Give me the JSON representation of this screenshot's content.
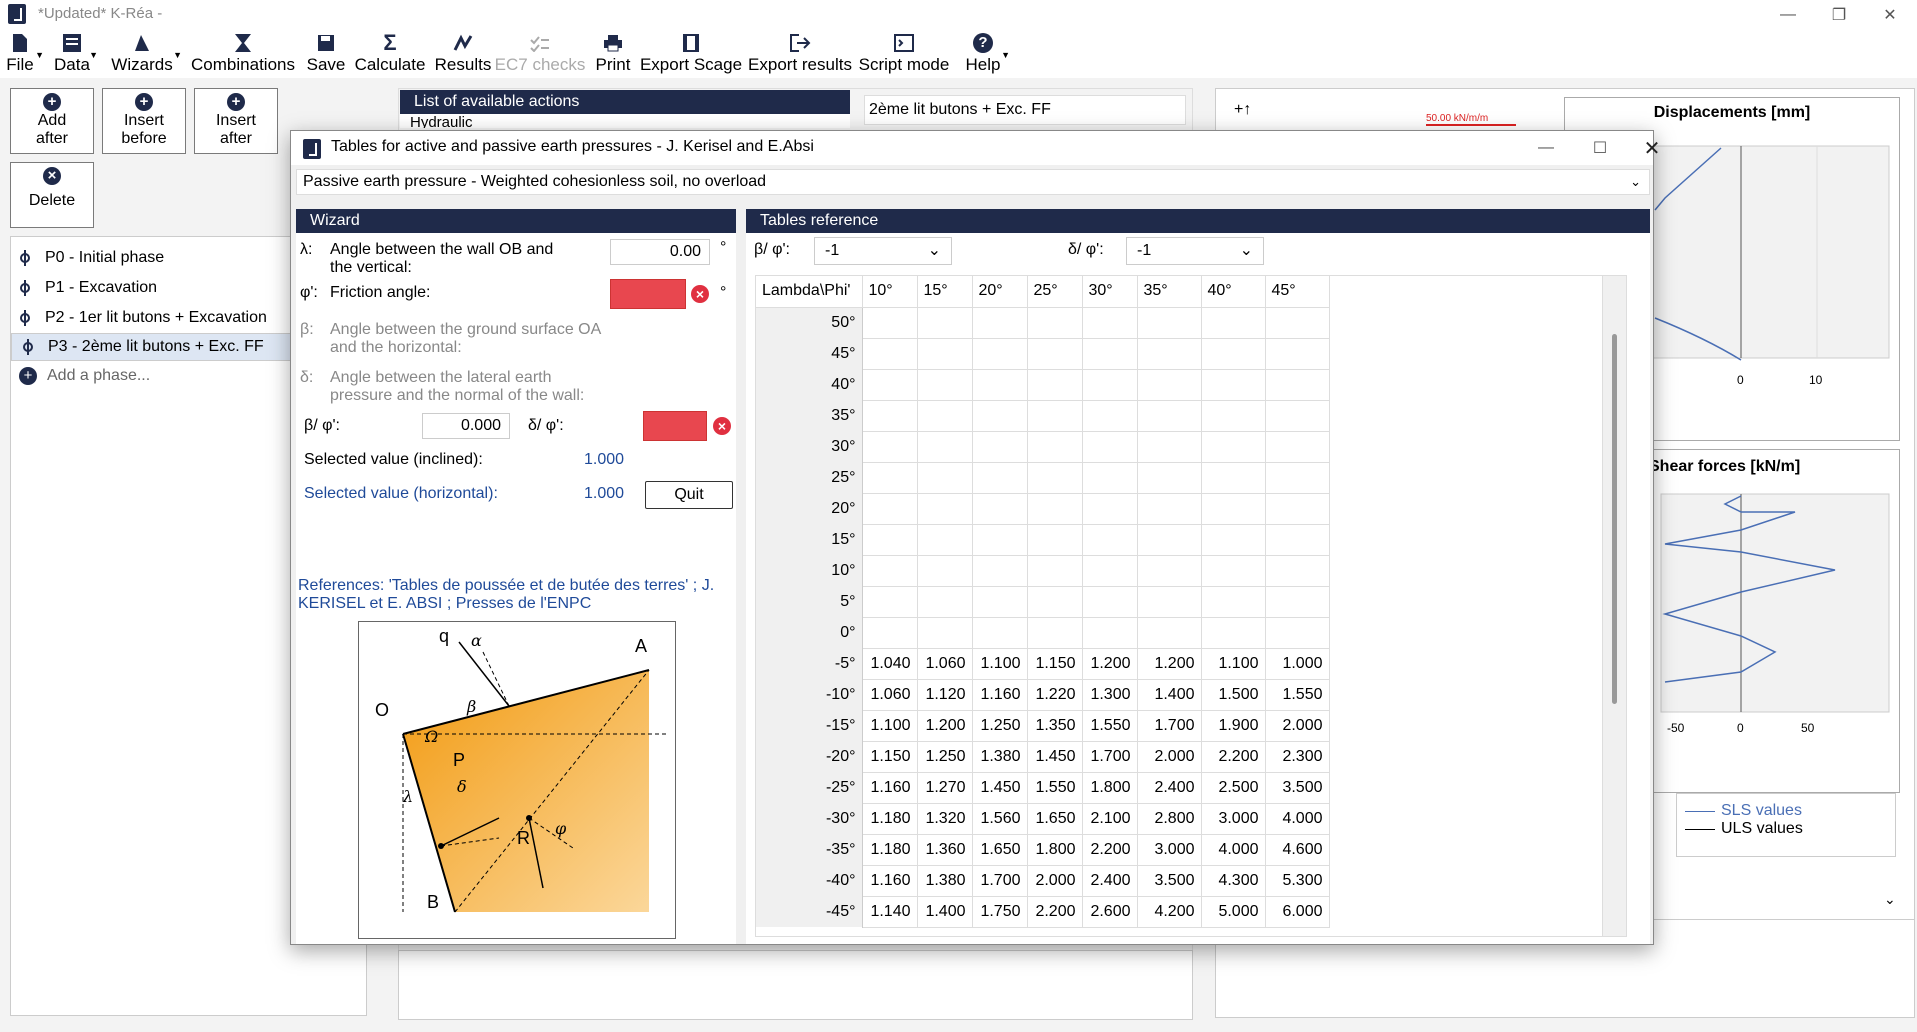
{
  "app": {
    "title": "*Updated* K-Réa -"
  },
  "ribbon": [
    {
      "label": "File",
      "icon": "file-icon",
      "dropdown": true
    },
    {
      "label": "Data",
      "icon": "data-icon",
      "dropdown": true
    },
    {
      "label": "Wizards",
      "icon": "wizard-hat-icon",
      "dropdown": true
    },
    {
      "label": "Combinations",
      "icon": "hourglass-icon"
    },
    {
      "label": "Save",
      "icon": "save-icon"
    },
    {
      "label": "Calculate",
      "icon": "sigma-icon"
    },
    {
      "label": "Results",
      "icon": "results-icon"
    },
    {
      "label": "EC7 checks",
      "icon": "checks-icon",
      "disabled": true
    },
    {
      "label": "Print",
      "icon": "printer-icon"
    },
    {
      "label": "Export Scage",
      "icon": "export-scage-icon"
    },
    {
      "label": "Export results",
      "icon": "export-icon"
    },
    {
      "label": "Script mode",
      "icon": "script-icon"
    },
    {
      "label": "Help",
      "icon": "help-icon",
      "dropdown": true
    }
  ],
  "phase_buttons": {
    "add_after": "Add\nafter",
    "insert_before": "Insert\nbefore",
    "insert_after": "Insert\nafter",
    "delete": "Delete"
  },
  "phases": [
    "P0 - Initial phase",
    "P1 - Excavation",
    "P2 - 1er lit butons + Excavation",
    "P3 - 2ème lit butons + Exc. FF"
  ],
  "phases_selected_index": 3,
  "add_phase": "Add a phase...",
  "actions": {
    "header": "List of available actions",
    "first_item": "Hydraulic"
  },
  "current_phase": "2ème lit butons + Exc. FF",
  "right_panel": {
    "toolbar_label": "+↑",
    "load_label": "50.00 kN/m/m",
    "displacements_title": "Displacements [mm]",
    "displacements_ticks": [
      "0",
      "10"
    ],
    "shear_title": "Shear forces [kN/m]",
    "shear_ticks": [
      "-50",
      "0",
      "50"
    ],
    "legend": [
      "SLS values",
      "ULS values"
    ]
  },
  "dialog": {
    "title": "Tables for active and passive earth pressures - J. Kerisel and E.Absi",
    "case": "Passive earth pressure - Weighted cohesionless soil, no overload",
    "wizard_header": "Wizard",
    "lambda_sym": "λ:",
    "lambda_label_1": "Angle between the wall OB and",
    "lambda_label_2": "the vertical:",
    "lambda_value": "0.00",
    "deg": "°",
    "phi_sym": "φ':",
    "phi_label": "Friction angle:",
    "beta_sym": "β:",
    "beta_label_1": "Angle between the ground surface OA",
    "beta_label_2": "and the horizontal:",
    "delta_sym": "δ:",
    "delta_label_1": "Angle between the lateral earth",
    "delta_label_2": "pressure and the normal of the wall:",
    "beta_phi_label": "β/ φ':",
    "beta_phi_value": "0.000",
    "delta_phi_label": "δ/ φ':",
    "selected_inclined_label": "Selected value (inclined):",
    "selected_inclined_value": "1.000",
    "selected_horizontal_label": "Selected value (horizontal):",
    "selected_horizontal_value": "1.000",
    "quit": "Quit",
    "references": "References: 'Tables de poussée et de butée des terres' ; J. KERISEL et E. ABSI ; Presses de l'ENPC",
    "diagram_labels": {
      "q": "q",
      "alpha": "α",
      "A": "A",
      "O": "O",
      "beta": "β",
      "Omega": "Ω",
      "P": "P",
      "delta": "δ",
      "lambda": "λ",
      "R": "R",
      "phi": "φ",
      "B": "B"
    },
    "tables_header": "Tables reference",
    "beta_phi_filter_label": "β/ φ':",
    "beta_phi_filter_value": "-1",
    "delta_phi_filter_label": "δ/ φ':",
    "delta_phi_filter_value": "-1"
  },
  "table": {
    "corner": "Lambda\\Phi'",
    "columns": [
      "10°",
      "15°",
      "20°",
      "25°",
      "30°",
      "35°",
      "40°",
      "45°"
    ],
    "rows": [
      {
        "label": "50°",
        "values": [
          "",
          "",
          "",
          "",
          "",
          "",
          "",
          ""
        ]
      },
      {
        "label": "45°",
        "values": [
          "",
          "",
          "",
          "",
          "",
          "",
          "",
          ""
        ]
      },
      {
        "label": "40°",
        "values": [
          "",
          "",
          "",
          "",
          "",
          "",
          "",
          ""
        ]
      },
      {
        "label": "35°",
        "values": [
          "",
          "",
          "",
          "",
          "",
          "",
          "",
          ""
        ]
      },
      {
        "label": "30°",
        "values": [
          "",
          "",
          "",
          "",
          "",
          "",
          "",
          ""
        ]
      },
      {
        "label": "25°",
        "values": [
          "",
          "",
          "",
          "",
          "",
          "",
          "",
          ""
        ]
      },
      {
        "label": "20°",
        "values": [
          "",
          "",
          "",
          "",
          "",
          "",
          "",
          ""
        ]
      },
      {
        "label": "15°",
        "values": [
          "",
          "",
          "",
          "",
          "",
          "",
          "",
          ""
        ]
      },
      {
        "label": "10°",
        "values": [
          "",
          "",
          "",
          "",
          "",
          "",
          "",
          ""
        ]
      },
      {
        "label": "5°",
        "values": [
          "",
          "",
          "",
          "",
          "",
          "",
          "",
          ""
        ]
      },
      {
        "label": "0°",
        "values": [
          "",
          "",
          "",
          "",
          "",
          "",
          "",
          ""
        ]
      },
      {
        "label": "-5°",
        "values": [
          "1.040",
          "1.060",
          "1.100",
          "1.150",
          "1.200",
          "1.200",
          "1.100",
          "1.000"
        ]
      },
      {
        "label": "-10°",
        "values": [
          "1.060",
          "1.120",
          "1.160",
          "1.220",
          "1.300",
          "1.400",
          "1.500",
          "1.550"
        ]
      },
      {
        "label": "-15°",
        "values": [
          "1.100",
          "1.200",
          "1.250",
          "1.350",
          "1.550",
          "1.700",
          "1.900",
          "2.000"
        ]
      },
      {
        "label": "-20°",
        "values": [
          "1.150",
          "1.250",
          "1.380",
          "1.450",
          "1.700",
          "2.000",
          "2.200",
          "2.300"
        ]
      },
      {
        "label": "-25°",
        "values": [
          "1.160",
          "1.270",
          "1.450",
          "1.550",
          "1.800",
          "2.400",
          "2.500",
          "3.500"
        ]
      },
      {
        "label": "-30°",
        "values": [
          "1.180",
          "1.320",
          "1.560",
          "1.650",
          "2.100",
          "2.800",
          "3.000",
          "4.000"
        ]
      },
      {
        "label": "-35°",
        "values": [
          "1.180",
          "1.360",
          "1.650",
          "1.800",
          "2.200",
          "3.000",
          "4.000",
          "4.600"
        ]
      },
      {
        "label": "-40°",
        "values": [
          "1.160",
          "1.380",
          "1.700",
          "2.000",
          "2.400",
          "3.500",
          "4.300",
          "5.300"
        ]
      },
      {
        "label": "-45°",
        "values": [
          "1.140",
          "1.400",
          "1.750",
          "2.200",
          "2.600",
          "4.200",
          "5.000",
          "6.000"
        ]
      }
    ]
  },
  "colors": {
    "navy": "#1f2a4a",
    "error_red": "#e8474f",
    "orange": "#f6a01a",
    "selected_blue": "#4a6fb5"
  }
}
